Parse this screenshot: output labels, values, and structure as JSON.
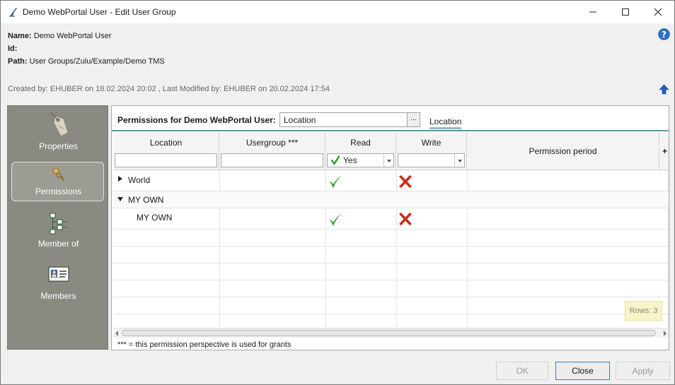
{
  "window": {
    "title": "Demo WebPortal User - Edit User Group"
  },
  "info": {
    "name_label": "Name:",
    "name_value": "Demo WebPortal User",
    "id_label": "Id:",
    "id_value": "",
    "path_label": "Path:",
    "path_value": "User Groups/Zulu/Example/Demo TMS",
    "created_text": "Created by: EHUBER on 18.02.2024 20:02 ,  Last Modified by: EHUBER on 20.02.2024 17:54"
  },
  "sidebar": {
    "items": [
      {
        "label": "Properties",
        "icon": "tag-icon",
        "selected": false
      },
      {
        "label": "Permissions",
        "icon": "keys-icon",
        "selected": true
      },
      {
        "label": "Member of",
        "icon": "hierarchy-icon",
        "selected": false
      },
      {
        "label": "Members",
        "icon": "id-card-icon",
        "selected": false
      }
    ]
  },
  "permissions": {
    "title": "Permissions for Demo WebPortal User:",
    "perspective_value": "Location",
    "perspective_button": "...",
    "tab_label": "Location",
    "columns": [
      "Location",
      "Usergroup ***",
      "Read",
      "Write",
      "Permission period"
    ],
    "read_filter": "Yes",
    "add_column": "+",
    "rows": [
      {
        "location": "World",
        "usergroup": "",
        "read": "yes",
        "write": "no",
        "period": "",
        "expandable": true,
        "expanded": false,
        "indent": 0
      },
      {
        "location": "MY OWN",
        "usergroup": "",
        "read": "",
        "write": "",
        "period": "",
        "expandable": true,
        "expanded": true,
        "indent": 0
      },
      {
        "location": "MY OWN",
        "usergroup": "",
        "read": "yes",
        "write": "no",
        "period": "",
        "expandable": false,
        "expanded": false,
        "indent": 1
      }
    ],
    "rows_count": "Rows: 3",
    "footnote": "*** = this permission perspective is used for grants"
  },
  "buttons": {
    "ok": "OK",
    "close": "Close",
    "apply": "Apply"
  },
  "colors": {
    "check_green": "#1e9c1e",
    "cross_red": "#cc2a14",
    "sidebar_bg": "#8a8a83",
    "accent": "#2f7bd8"
  }
}
